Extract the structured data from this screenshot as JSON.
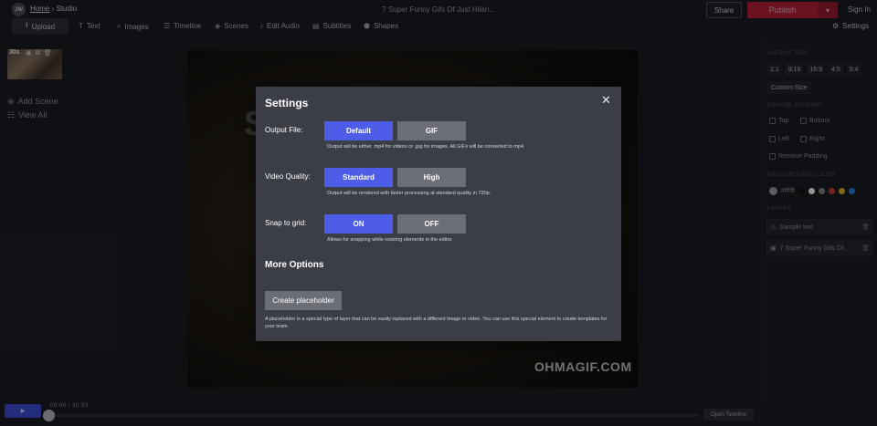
{
  "header": {
    "avatar_initials": "JW",
    "breadcrumb_home": "Home",
    "breadcrumb_sep": "›",
    "breadcrumb_current": "Studio",
    "project_title": "7 Super Funny Gifs Of Just Hilari...",
    "share": "Share",
    "publish": "Publish",
    "publish_caret": "▾",
    "sign_in": "Sign In"
  },
  "toolbar": {
    "upload": "Upload",
    "text": "Text",
    "images": "Images",
    "timeline": "Timeline",
    "scenes": "Scenes",
    "edit_audio": "Edit Audio",
    "subtitles": "Subtitles",
    "shapes": "Shapes",
    "settings": "Settings"
  },
  "left_panel": {
    "scene_duration": "30s",
    "add_scene": "Add Scene",
    "view_all": "View All"
  },
  "canvas": {
    "watermark": "OHMAGIF.COM",
    "big_letter": "S"
  },
  "right_panel": {
    "output_size_label": "OUTPUT SIZE",
    "ratios": [
      "1:1",
      "9:16",
      "16:9",
      "4:5",
      "5:4"
    ],
    "custom_size": "Custom Size",
    "expand_padding_label": "EXPAND PADDING",
    "top": "Top",
    "bottom": "Bottom",
    "left": "Left",
    "right": "Right",
    "remove_padding": "Remove Padding",
    "background_color_label": "BACKGROUND COLOR",
    "bg_hex": "#ffffff",
    "swatch_colors": [
      "#111111",
      "#ffffff",
      "#888888",
      "#d33a3a",
      "#e0b12a",
      "#2a7be0"
    ],
    "layers_label": "LAYERS",
    "layers": [
      {
        "name": "Sample text"
      },
      {
        "name": "7 Super Funny Gifs Of..."
      }
    ]
  },
  "bottom": {
    "play": "▶",
    "time_current": "00.00",
    "time_sep": "/",
    "time_total": "30.03",
    "open_timeline": "Open Timeline"
  },
  "modal": {
    "title": "Settings",
    "close": "✕",
    "output_file": {
      "label": "Output File:",
      "opt_a": "Default",
      "opt_b": "GIF",
      "hint": "Output will be either .mp4 for videos or .jpg for images. All GIFs will be converted to mp4."
    },
    "video_quality": {
      "label": "Video Quality:",
      "opt_a": "Standard",
      "opt_b": "High",
      "hint": "Output will be rendered with faster processing at standard quality in 720p."
    },
    "snap_to_grid": {
      "label": "Snap to grid:",
      "opt_a": "ON",
      "opt_b": "OFF",
      "hint": "Allows for snapping while resizing elements in the editor."
    },
    "more_options": "More Options",
    "create_placeholder": "Create placeholder",
    "placeholder_desc": "A placeholder is a special type of layer that can be easily replaced with a different image or video. You can use this special element to create templates for your team."
  },
  "colors": {
    "accent": "#4e5de8",
    "publish": "#b8203a",
    "modal_bg": "#3b3e46"
  }
}
